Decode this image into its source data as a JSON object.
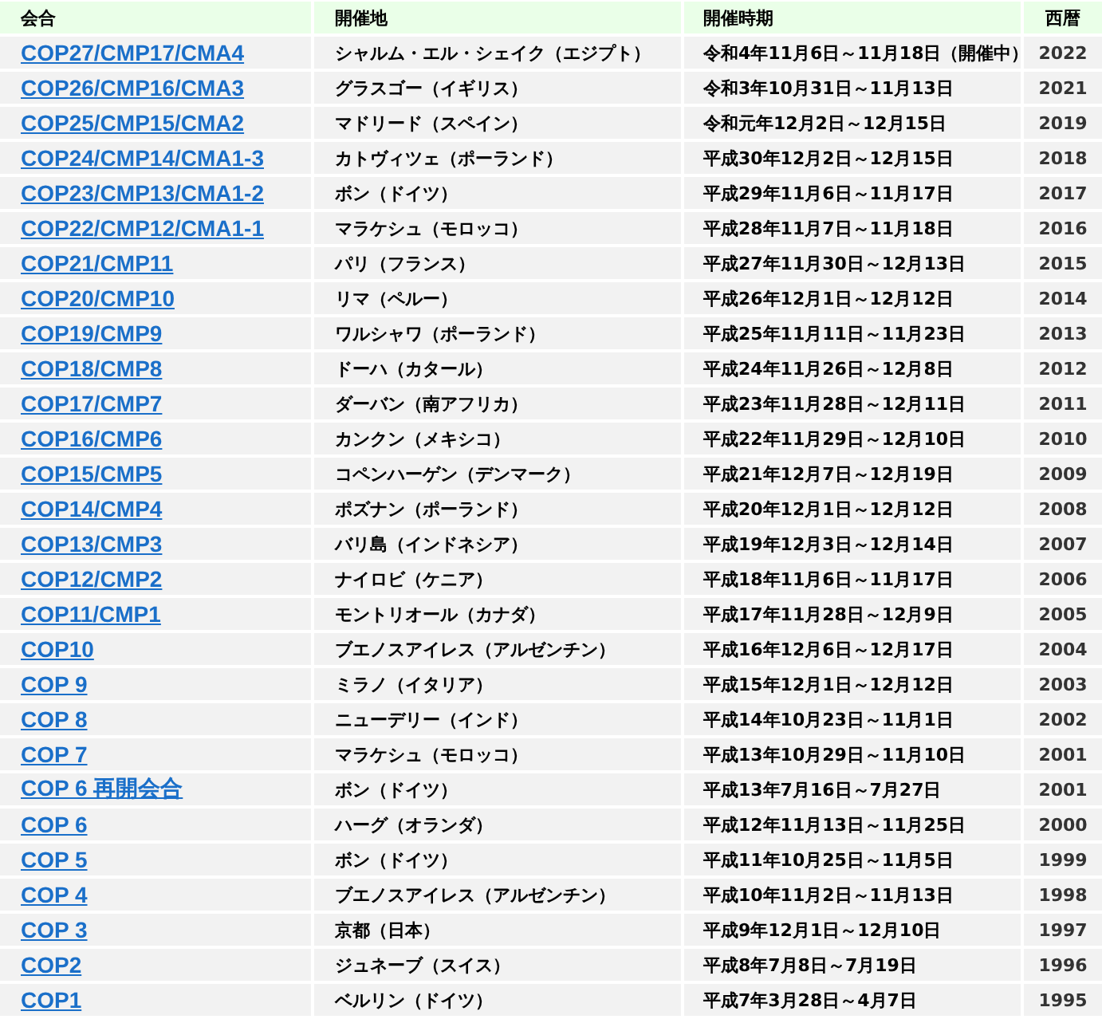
{
  "table": {
    "columns": [
      "会合",
      "開催地",
      "開催時期",
      "西暦"
    ],
    "rows": [
      {
        "meeting": "COP27/CMP17/CMA4",
        "venue": "シャルム・エル・シェイク（エジプト）",
        "period": "令和4年11月6日～11月18日（開催中）",
        "year": "2022"
      },
      {
        "meeting": "COP26/CMP16/CMA3",
        "venue": "グラスゴー（イギリス）",
        "period": "令和3年10月31日～11月13日",
        "year": "2021"
      },
      {
        "meeting": "COP25/CMP15/CMA2",
        "venue": "マドリード（スペイン）",
        "period": "令和元年12月2日～12月15日",
        "year": "2019"
      },
      {
        "meeting": "COP24/CMP14/CMA1-3",
        "venue": "カトヴィツェ（ポーランド）",
        "period": "平成30年12月2日～12月15日",
        "year": "2018"
      },
      {
        "meeting": "COP23/CMP13/CMA1-2",
        "venue": "ボン（ドイツ）",
        "period": "平成29年11月6日～11月17日",
        "year": "2017"
      },
      {
        "meeting": "COP22/CMP12/CMA1-1",
        "venue": "マラケシュ（モロッコ）",
        "period": "平成28年11月7日～11月18日",
        "year": "2016"
      },
      {
        "meeting": "COP21/CMP11",
        "venue": "パリ（フランス）",
        "period": "平成27年11月30日～12月13日",
        "year": "2015"
      },
      {
        "meeting": "COP20/CMP10",
        "venue": "リマ（ペルー）",
        "period": "平成26年12月1日～12月12日",
        "year": "2014"
      },
      {
        "meeting": "COP19/CMP9",
        "venue": "ワルシャワ（ポーランド）",
        "period": "平成25年11月11日～11月23日",
        "year": "2013"
      },
      {
        "meeting": "COP18/CMP8",
        "venue": "ドーハ（カタール）",
        "period": "平成24年11月26日～12月8日",
        "year": "2012"
      },
      {
        "meeting": "COP17/CMP7",
        "venue": "ダーバン（南アフリカ）",
        "period": "平成23年11月28日～12月11日",
        "year": "2011"
      },
      {
        "meeting": "COP16/CMP6",
        "venue": "カンクン（メキシコ）",
        "period": "平成22年11月29日～12月10日",
        "year": "2010"
      },
      {
        "meeting": "COP15/CMP5",
        "venue": "コペンハーゲン（デンマーク）",
        "period": "平成21年12月7日～12月19日",
        "year": "2009"
      },
      {
        "meeting": "COP14/CMP4",
        "venue": "ポズナン（ポーランド）",
        "period": "平成20年12月1日～12月12日",
        "year": "2008"
      },
      {
        "meeting": "COP13/CMP3",
        "venue": "バリ島（インドネシア）",
        "period": "平成19年12月3日～12月14日",
        "year": "2007"
      },
      {
        "meeting": "COP12/CMP2",
        "venue": "ナイロビ（ケニア）",
        "period": "平成18年11月6日～11月17日",
        "year": "2006"
      },
      {
        "meeting": "COP11/CMP1",
        "venue": "モントリオール（カナダ）",
        "period": "平成17年11月28日～12月9日",
        "year": "2005"
      },
      {
        "meeting": "COP10",
        "venue": "ブエノスアイレス（アルゼンチン）",
        "period": "平成16年12月6日～12月17日",
        "year": "2004"
      },
      {
        "meeting": "COP 9",
        "venue": "ミラノ（イタリア）",
        "period": "平成15年12月1日～12月12日",
        "year": "2003"
      },
      {
        "meeting": "COP 8",
        "venue": "ニューデリー（インド）",
        "period": "平成14年10月23日～11月1日",
        "year": "2002"
      },
      {
        "meeting": "COP 7",
        "venue": "マラケシュ（モロッコ）",
        "period": "平成13年10月29日～11月10日",
        "year": "2001"
      },
      {
        "meeting": "COP 6 再開会合",
        "venue": "ボン（ドイツ）",
        "period": "平成13年7月16日～7月27日",
        "year": "2001"
      },
      {
        "meeting": "COP 6",
        "venue": "ハーグ（オランダ）",
        "period": "平成12年11月13日～11月25日",
        "year": "2000"
      },
      {
        "meeting": "COP 5",
        "venue": "ボン（ドイツ）",
        "period": "平成11年10月25日～11月5日",
        "year": "1999"
      },
      {
        "meeting": "COP 4",
        "venue": "ブエノスアイレス（アルゼンチン）",
        "period": "平成10年11月2日～11月13日",
        "year": "1998"
      },
      {
        "meeting": "COP 3",
        "venue": "京都（日本）",
        "period": "平成9年12月1日～12月10日",
        "year": "1997"
      },
      {
        "meeting": "COP2",
        "venue": "ジュネーブ（スイス）",
        "period": "平成8年7月8日～7月19日",
        "year": "1996"
      },
      {
        "meeting": "COP1",
        "venue": "ベルリン（ドイツ）",
        "period": "平成7年3月28日～4月7日",
        "year": "1995"
      }
    ]
  }
}
